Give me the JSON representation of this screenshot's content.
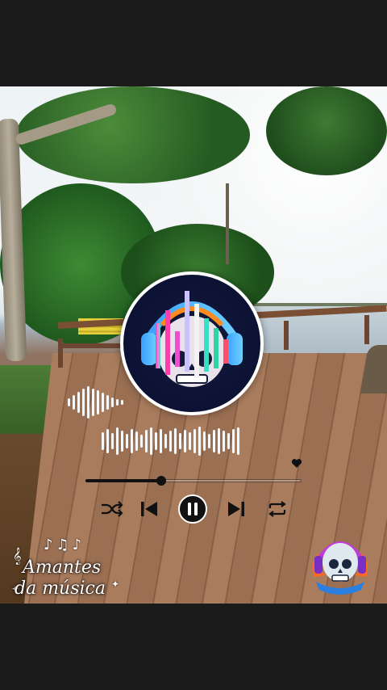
{
  "player": {
    "like_icon": "heart-icon",
    "progress_fraction": 0.35,
    "controls": {
      "shuffle": "shuffle-icon",
      "previous": "skip-previous-icon",
      "play_pause": "pause-icon",
      "next": "skip-next-icon",
      "repeat": "repeat-icon"
    }
  },
  "brand": {
    "line1": "Amantes",
    "line2": "da música",
    "notes": "♪♫♪"
  },
  "colors": {
    "background_bars": "#1b1b1b",
    "control_color": "#111111",
    "wave_color": "#ffffff"
  }
}
